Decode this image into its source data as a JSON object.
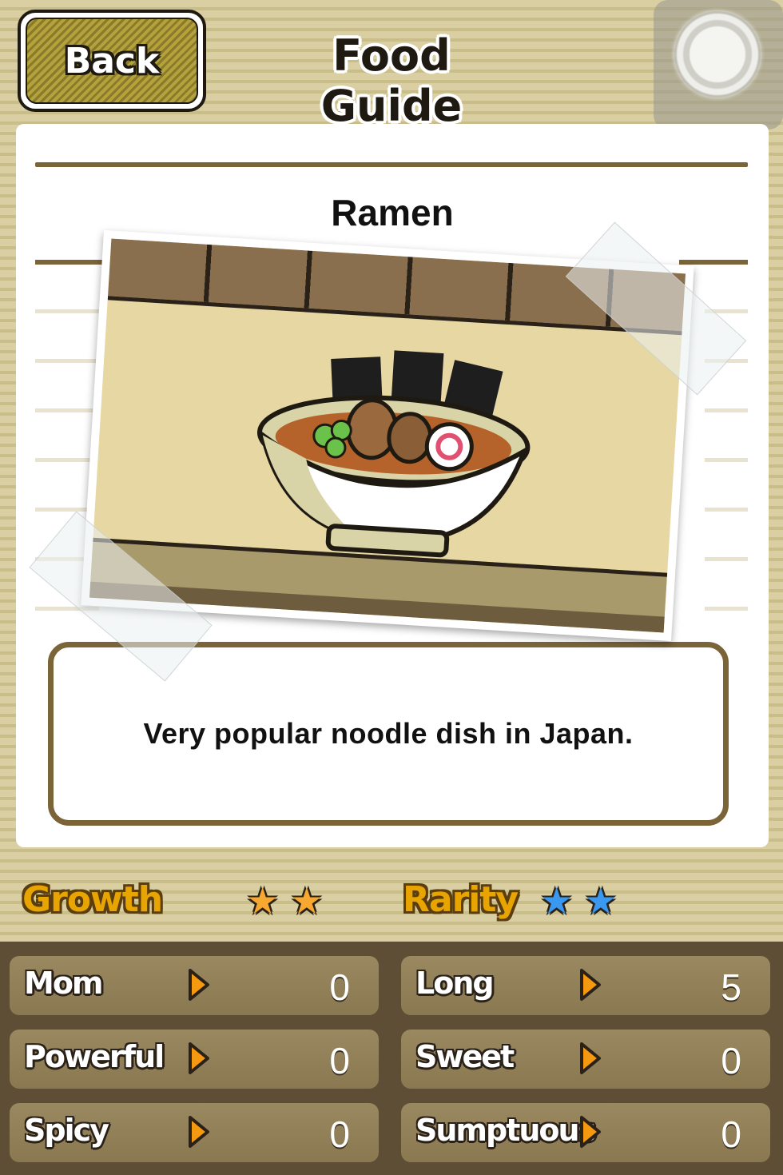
{
  "header": {
    "back_label": "Back",
    "title": "Food Guide"
  },
  "food": {
    "name": "Ramen",
    "description": "Very popular noodle dish in Japan."
  },
  "ratings": {
    "growth_label": "Growth",
    "growth_stars": 2,
    "growth_color": "#f6a830",
    "rarity_label": "Rarity",
    "rarity_stars": 2,
    "rarity_color": "#3a98f0"
  },
  "stats": [
    {
      "name": "Mom",
      "value": "0"
    },
    {
      "name": "Long",
      "value": "5"
    },
    {
      "name": "Powerful",
      "value": "0"
    },
    {
      "name": "Sweet",
      "value": "0"
    },
    {
      "name": "Spicy",
      "value": "0"
    },
    {
      "name": "Sumptuous",
      "value": "0"
    }
  ]
}
